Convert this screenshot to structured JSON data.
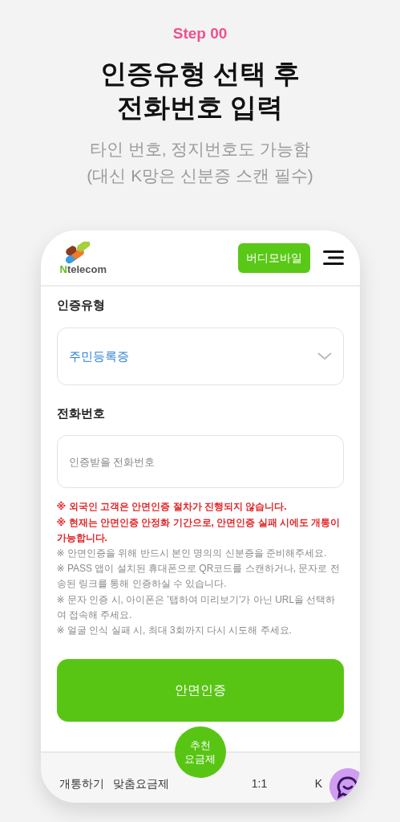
{
  "step": "Step 00",
  "title": [
    "인증유형 선택 후",
    "전화번호 입력"
  ],
  "subtitle": [
    "타인 번호, 정지번호도 가능함",
    "(대신 K망은 신분증 스캔 필수)"
  ],
  "app": {
    "logo": "Ntelecom",
    "header_button": "버디모바일",
    "form": [
      {
        "kind": "select",
        "label": "인증유형",
        "value": "주민등록증"
      },
      {
        "kind": "input",
        "label": "전화번호",
        "placeholder": "인증받을 전화번호"
      }
    ],
    "notes": [
      {
        "kind": "warning",
        "text": "※ 외국인 고객은 안면인증 절차가 진행되지 않습니다."
      },
      {
        "kind": "warning",
        "text": "※ 현재는 안면인증 안정화 기간으로, 안면인증 실패 시에도 개통이 가능합니다."
      },
      {
        "kind": "info",
        "text": "※ 안면인증을 위해 반드시 본인 명의의 신분증을 준비해주세요."
      },
      {
        "kind": "info",
        "text": "※ PASS 앱이 설치된 휴대폰으로 QR코드를 스캔하거나, 문자로 전송된 링크를 통해 인증하실 수 있습니다."
      },
      {
        "kind": "info",
        "text": "※ 문자 인증 시, 아이폰은 '탭하여 미리보기'가 아닌 URL을 선택하여 접속해 주세요."
      },
      {
        "kind": "info",
        "text": "※ 얼굴 인식 실패 시, 최대 3회까지 다시 시도해 주세요."
      }
    ],
    "submit": "안면인증",
    "fab": [
      "추천",
      "요금제"
    ],
    "nav": [
      {
        "kind": "text",
        "label": "개통하기"
      },
      {
        "kind": "text",
        "label": "맞춤요금제"
      },
      {
        "kind": "gap"
      },
      {
        "kind": "text",
        "label": "1:1"
      },
      {
        "kind": "text",
        "label": "K"
      }
    ]
  }
}
